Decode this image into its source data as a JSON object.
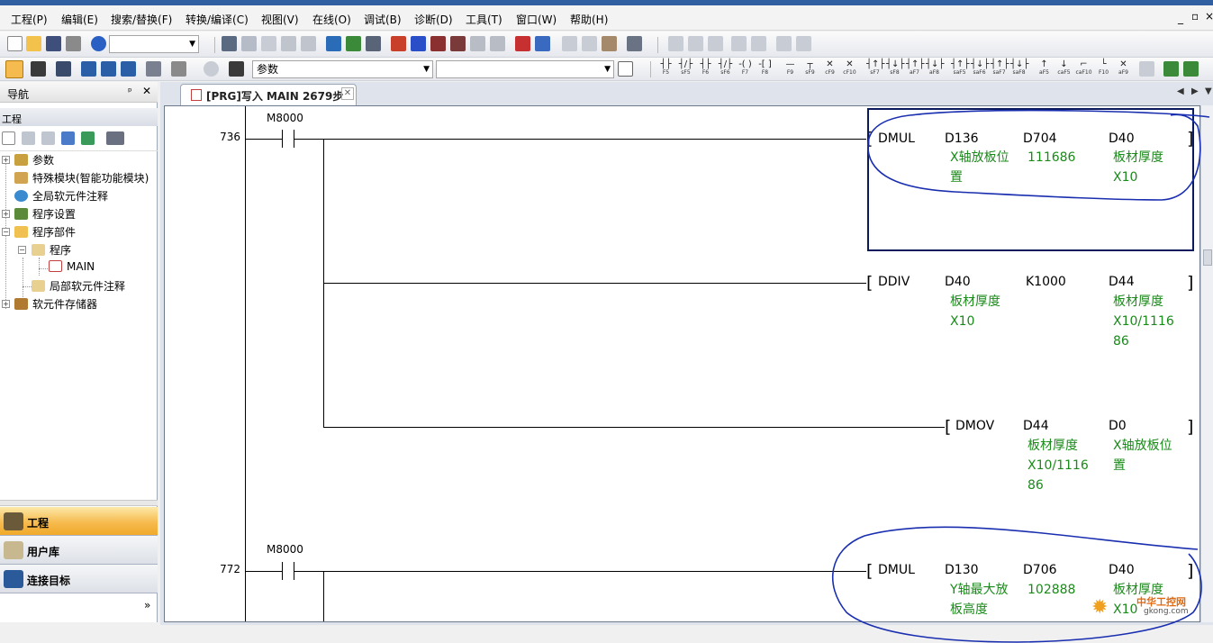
{
  "menu": {
    "items": [
      "工程(P)",
      "编辑(E)",
      "搜索/替换(F)",
      "转换/编译(C)",
      "视图(V)",
      "在线(O)",
      "调试(B)",
      "诊断(D)",
      "工具(T)",
      "窗口(W)",
      "帮助(H)"
    ],
    "minimize": "_",
    "restore": "▫",
    "close": "×"
  },
  "toolbar": {
    "search_combo_value": "参数",
    "fkeys": [
      {
        "glyph": "┤├",
        "label": "F5"
      },
      {
        "glyph": "┤/├",
        "label": "sF5"
      },
      {
        "glyph": "┤├",
        "label": "F6"
      },
      {
        "glyph": "┤/├",
        "label": "sF6"
      },
      {
        "glyph": "-( )",
        "label": "F7"
      },
      {
        "glyph": "-[ ]",
        "label": "F8"
      },
      {
        "glyph": "—",
        "label": "F9"
      },
      {
        "glyph": "┬",
        "label": "sF9"
      },
      {
        "glyph": "✕",
        "label": "cF9"
      },
      {
        "glyph": "✕",
        "label": "cF10"
      },
      {
        "glyph": "┤↑├",
        "label": "sF7"
      },
      {
        "glyph": "┤↓├",
        "label": "sF8"
      },
      {
        "glyph": "┤↑├",
        "label": "aF7"
      },
      {
        "glyph": "┤↓├",
        "label": "aF8"
      },
      {
        "glyph": "┤↑├",
        "label": "saF5"
      },
      {
        "glyph": "┤↓├",
        "label": "saF6"
      },
      {
        "glyph": "┤↑├",
        "label": "saF7"
      },
      {
        "glyph": "┤↓├",
        "label": "saF8"
      },
      {
        "glyph": "↑",
        "label": "aF5"
      },
      {
        "glyph": "↓",
        "label": "caF5"
      },
      {
        "glyph": "⌐",
        "label": "caF10"
      },
      {
        "glyph": "└",
        "label": "F10"
      },
      {
        "glyph": "✕",
        "label": "aF9"
      }
    ]
  },
  "nav": {
    "title": "导航",
    "pin": "ᵖ",
    "close": "✕",
    "section": "工程",
    "tree": [
      {
        "label": "参数",
        "icon": "gear-globe-icon"
      },
      {
        "label": "特殊模块(智能功能模块)",
        "icon": "module-icon"
      },
      {
        "label": "全局软元件注释",
        "icon": "globe-icon"
      },
      {
        "label": "程序设置",
        "icon": "program-setting-icon"
      },
      {
        "label": "程序部件",
        "icon": "folder-open-icon"
      },
      {
        "label": "程序",
        "icon": "folder-icon"
      },
      {
        "label": "MAIN",
        "icon": "program-file-icon"
      },
      {
        "label": "局部软元件注释",
        "icon": "folder-icon"
      },
      {
        "label": "软元件存储器",
        "icon": "memory-icon"
      }
    ],
    "bottom_tabs": [
      "工程",
      "用户库",
      "连接目标"
    ],
    "expand_chevron": "»"
  },
  "document_tab": {
    "label": "[PRG]写入 MAIN 2679步",
    "close": "✕"
  },
  "ladder": {
    "rungs": [
      {
        "step": "736",
        "contact": "M8000",
        "instructions": [
          {
            "name": "DMUL",
            "operands": [
              "D136",
              "D704",
              "D40"
            ],
            "comments": [
              "X轴放板位\n置",
              "111686",
              "板材厚度\nX10"
            ]
          },
          {
            "name": "DDIV",
            "operands": [
              "D40",
              "K1000",
              "D44"
            ],
            "comments": [
              "板材厚度\nX10",
              "",
              "板材厚度\nX10/1116\n86"
            ]
          },
          {
            "name": "DMOV",
            "operands": [
              "D44",
              "D0"
            ],
            "comments": [
              "板材厚度\nX10/1116\n86",
              "X轴放板位\n置"
            ]
          }
        ]
      },
      {
        "step": "772",
        "contact": "M8000",
        "instructions": [
          {
            "name": "DMUL",
            "operands": [
              "D130",
              "D706",
              "D40"
            ],
            "comments": [
              "Y轴最大放\n板高度",
              "102888",
              "板材厚度\nX10"
            ]
          }
        ]
      }
    ]
  },
  "watermark": {
    "line1": "中华工控网",
    "line2": "gkong.com"
  },
  "colors": {
    "comment_text": "#1a8a1a",
    "annotation_ink": "#1a2fb0",
    "active_tab": "#f6bb4f",
    "title_bar": "#2f5fa0"
  }
}
